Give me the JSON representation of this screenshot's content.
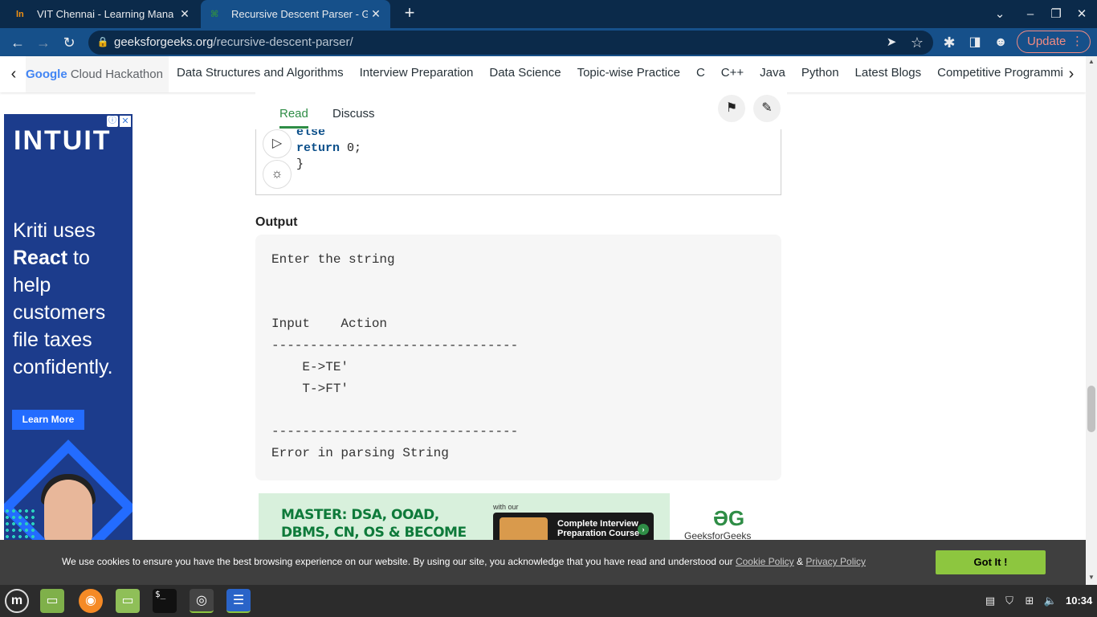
{
  "browser": {
    "tabs": [
      {
        "favicon": "ln",
        "title": "VIT Chennai - Learning Managem"
      },
      {
        "favicon": "⌘",
        "title": "Recursive Descent Parser - Geek"
      }
    ],
    "new_tab": "+",
    "url_domain": "geeksforgeeks.org",
    "url_path": "/recursive-descent-parser/",
    "update_label": "Update",
    "update_dots": "⋮"
  },
  "site_nav": {
    "google_cloud_hackathon": {
      "google": "Google",
      "rest": " Cloud Hackathon"
    },
    "items": [
      "Data Structures and Algorithms",
      "Interview Preparation",
      "Data Science",
      "Topic-wise Practice",
      "C",
      "C++",
      "Java",
      "Python",
      "Latest Blogs",
      "Competitive Programming"
    ]
  },
  "ad": {
    "info": "ⓘ",
    "close": "✕",
    "brand": "INTUIT",
    "copy_pre": "Kriti uses",
    "copy_bold": "React",
    "copy_post": "to help customers file taxes confidently.",
    "cta": "Learn More"
  },
  "article_tabs": {
    "read": "Read",
    "discuss": "Discuss"
  },
  "code": {
    "cut_line": "else",
    "line1_kw": "return",
    "line1_rest": " 0;",
    "line2": "}"
  },
  "output": {
    "heading": "Output",
    "text": "Enter the string\n\n\nInput    Action\n--------------------------------\n    E->TE'\n    T->FT'\n\n--------------------------------\nError in parsing String"
  },
  "banner": {
    "headline": "MASTER: DSA, OOAD, DBMS, CN, OS & BECOME INTERVIEW READY",
    "with_our": "with our",
    "course": "Complete Interview Preparation Course",
    "go": "›",
    "logo_mark": "ƏG",
    "brand": "GeeksforGeeks"
  },
  "cookie": {
    "message": "We use cookies to ensure you have the best browsing experience on our website. By using our site, you acknowledge that you have read and understood our ",
    "cookie_policy": "Cookie Policy",
    "amp": " & ",
    "privacy_policy": "Privacy Policy",
    "button": "Got It !"
  },
  "taskbar": {
    "terminal_label": "$_",
    "time": "10:34"
  }
}
